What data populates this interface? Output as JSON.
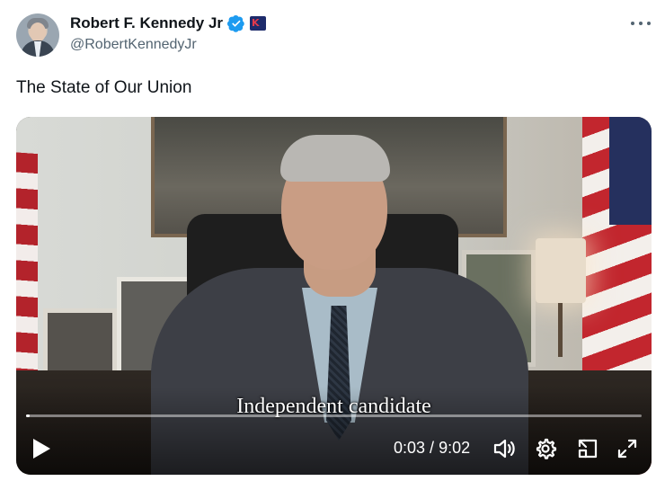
{
  "author": {
    "display_name": "Robert F. Kennedy Jr",
    "handle": "@RobertKennedyJr",
    "verified_icon": "verified-check-icon",
    "affiliate_badge_icon": "kennedy-campaign-badge-icon"
  },
  "tweet": {
    "text": "The State of Our Union"
  },
  "video": {
    "subtitle": "Independent candidate",
    "current_time": "0:03",
    "duration": "9:02",
    "time_separator": " / ",
    "progress_fraction": 0.006,
    "icons": [
      "play-icon",
      "volume-icon",
      "settings-gear-icon",
      "picture-in-picture-icon",
      "fullscreen-icon"
    ]
  },
  "colors": {
    "verified_blue": "#1d9bf0",
    "text_primary": "#0f1419",
    "text_secondary": "#536471",
    "badge_navy": "#1d2b6b",
    "badge_red": "#e23a4c"
  }
}
